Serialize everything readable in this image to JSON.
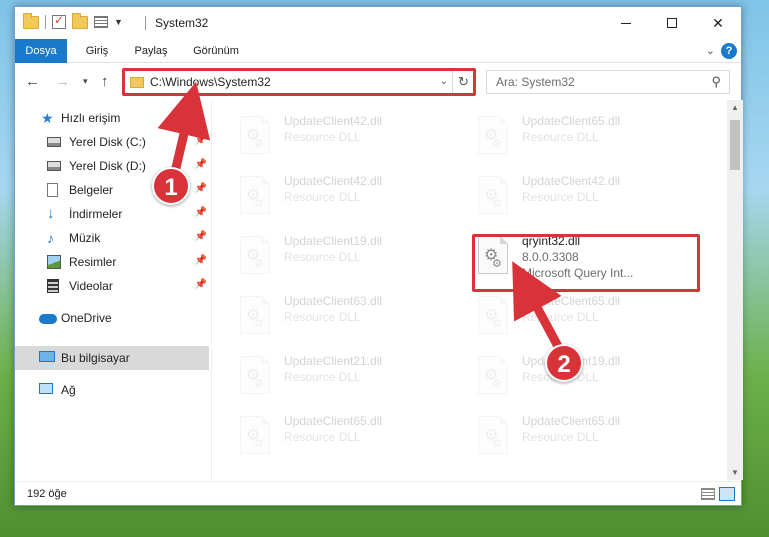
{
  "window": {
    "title": "System32",
    "controls": {
      "minimize": "–",
      "maximize": "☐",
      "close": "✕"
    }
  },
  "ribbon": {
    "tabs": [
      {
        "label": "Dosya",
        "active": true
      },
      {
        "label": "Giriş"
      },
      {
        "label": "Paylaş"
      },
      {
        "label": "Görünüm"
      }
    ],
    "expand_icon": "⌄",
    "help_icon": "?"
  },
  "nav": {
    "back": "←",
    "forward": "→",
    "recent": "▾",
    "up": "↑"
  },
  "address": {
    "path": "C:\\Windows\\System32",
    "dropdown": "⌄",
    "refresh": "↻"
  },
  "search": {
    "placeholder": "Ara: System32",
    "icon": "⚲"
  },
  "sidebar": {
    "items": [
      {
        "label": "Hızlı erişim",
        "icon": "star-icon"
      },
      {
        "label": "Yerel Disk (C:)",
        "icon": "disk-icon",
        "pinned": true
      },
      {
        "label": "Yerel Disk (D:)",
        "icon": "disk-icon",
        "pinned": true
      },
      {
        "label": "Belgeler",
        "icon": "document-icon",
        "pinned": true
      },
      {
        "label": "İndirmeler",
        "icon": "download-icon",
        "pinned": true
      },
      {
        "label": "Müzik",
        "icon": "music-icon",
        "pinned": true
      },
      {
        "label": "Resimler",
        "icon": "pictures-icon",
        "pinned": true
      },
      {
        "label": "Videolar",
        "icon": "videos-icon",
        "pinned": true
      },
      {
        "label": "OneDrive",
        "icon": "onedrive-icon"
      },
      {
        "label": "Bu bilgisayar",
        "icon": "computer-icon",
        "selected": true
      },
      {
        "label": "Ağ",
        "icon": "network-icon"
      }
    ],
    "pin_glyph": "📌"
  },
  "files": [
    {
      "name": "UpdateClient42.dll",
      "desc": "Resource DLL",
      "faded": true
    },
    {
      "name": "UpdateClient65.dll",
      "desc": "Resource DLL",
      "faded": true
    },
    {
      "name": "UpdateClient42.dll",
      "desc": "Resource DLL",
      "faded": true
    },
    {
      "name": "UpdateClient42.dll",
      "desc": "Resource DLL",
      "faded": true
    },
    {
      "name": "UpdateClient19.dll",
      "desc": "Resource DLL",
      "faded": true
    },
    {
      "name": "qryint32.dll",
      "desc": "8.0.0.3308",
      "desc2": "Microsoft Query Int...",
      "faded": false
    },
    {
      "name": "UpdateClient63.dll",
      "desc": "Resource DLL",
      "faded": true
    },
    {
      "name": "UpdateClient65.dll",
      "desc": "Resource DLL",
      "faded": true
    },
    {
      "name": "UpdateClient21.dll",
      "desc": "Resource DLL",
      "faded": true
    },
    {
      "name": "UpdateClient19.dll",
      "desc": "Resource DLL",
      "faded": true
    },
    {
      "name": "UpdateClient65.dll",
      "desc": "Resource DLL",
      "faded": true
    },
    {
      "name": "UpdateClient65.dll",
      "desc": "Resource DLL",
      "faded": true
    }
  ],
  "status": {
    "item_count": "192 öğe"
  },
  "annotations": {
    "step1": "1",
    "step2": "2",
    "highlight_color": "#d9333a"
  },
  "colors": {
    "accent": "#1979ca",
    "annotation_red": "#d9333a"
  }
}
